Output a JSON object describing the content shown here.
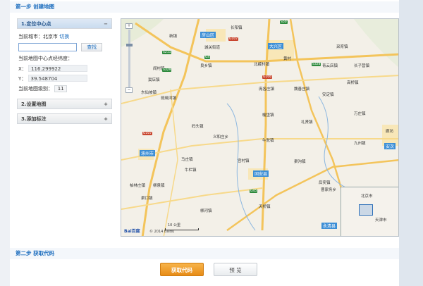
{
  "steps": {
    "step1": "第一步 创建地图",
    "step2": "第二步 获取代码"
  },
  "panel": {
    "section1": {
      "title": "1.定位中心点",
      "toggle": "−"
    },
    "current_city_label": "当前城市：北京市",
    "switch_link": "切换",
    "search_value": "",
    "search_button": "查找",
    "center_label": "当前地图中心点经纬度：",
    "x_label": "X：",
    "x_value": "116.299922",
    "y_label": "Y：",
    "y_value": "39.548704",
    "zoom_label": "当前地图级别：",
    "zoom_value": "11",
    "section2": {
      "title": "2.设置地图",
      "toggle": "+"
    },
    "section3": {
      "title": "3.添加标注",
      "toggle": "+"
    }
  },
  "map": {
    "places": [
      "长阳镇",
      "新镇",
      "房山区",
      "良乡镇",
      "城关街道",
      "阎村镇",
      "窦店镇",
      "琉璃河镇",
      "固安县",
      "涿州市",
      "码头镇",
      "义和庄乡",
      "宫村镇",
      "牛驼镇",
      "柳泉镇",
      "大兴区",
      "黄村",
      "北臧村镇",
      "庞各庄镇",
      "礼贤镇",
      "魏善庄镇",
      "安定镇",
      "采育镇",
      "青云店镇",
      "长子营镇",
      "万庄镇",
      "九州镇",
      "廊坊",
      "安次",
      "渠沟镇",
      "高桥镇",
      "榆垡镇",
      "东仙坡镇",
      "马庄镇",
      "渠口镇",
      "柏林庄镇",
      "永清县",
      "后奕镇",
      "曹家务乡",
      "柳河镇",
      "天桥镇",
      "牛栏镇"
    ],
    "shields": [
      "S50",
      "G107",
      "G106",
      "S329",
      "S328",
      "S211",
      "G45",
      "G107",
      "G4"
    ],
    "scale": "10 公里",
    "copyright": "© 2014 Baidu",
    "logo": "Bai百度",
    "minimap": {
      "city1": "北京市",
      "city2": "天津市"
    },
    "zoom_in": "+",
    "zoom_out": "−"
  },
  "actions": {
    "get_code": "获取代码",
    "preview": "预 览"
  }
}
